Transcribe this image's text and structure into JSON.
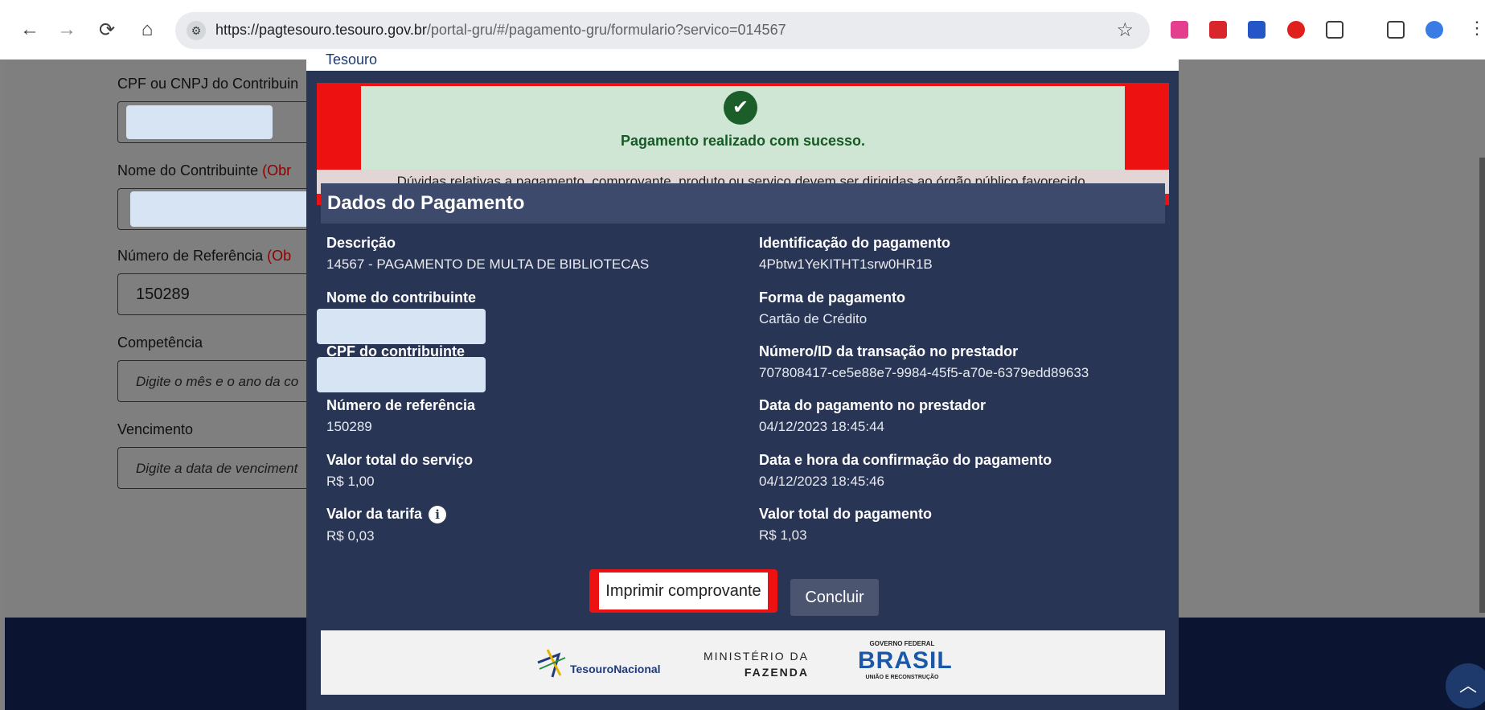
{
  "browser": {
    "url_host": "https://pagtesouro.tesouro.gov.br",
    "url_path": "/portal-gru/#/pagamento-gru/formulario?servico=014567"
  },
  "form": {
    "cpf_label": "CPF ou CNPJ do Contribuin",
    "nome_label": "Nome do Contribuinte",
    "nome_req": "(Obr",
    "ref_label": "Número de Referência",
    "ref_req": "(Ob",
    "ref_value": "150289",
    "competencia_label": "Competência",
    "competencia_placeholder": "Digite o mês e o ano da co",
    "vencimento_label": "Vencimento",
    "vencimento_placeholder": "Digite a data de venciment"
  },
  "modal": {
    "logo_text": "Tesouro",
    "success_title": "Pagamento realizado com sucesso.",
    "success_note": "Dúvidas relativas a pagamento, comprovante, produto ou serviço devem ser dirigidas ao órgão público favorecido.",
    "section_title": "Dados do Pagamento",
    "left_fields": [
      {
        "label": "Descrição",
        "value": "14567 - PAGAMENTO DE MULTA DE BIBLIOTECAS"
      },
      {
        "label": "Nome do contribuinte",
        "value": ""
      },
      {
        "label": "CPF do contribuinte",
        "value": ""
      },
      {
        "label": "Número de referência",
        "value": "150289"
      },
      {
        "label": "Valor total do serviço",
        "value": "R$  1,00"
      },
      {
        "label": "Valor da tarifa",
        "value": "R$  0,03"
      }
    ],
    "right_fields": [
      {
        "label": "Identificação do pagamento",
        "value": "4Pbtw1YeKITHT1srw0HR1B"
      },
      {
        "label": "Forma de pagamento",
        "value": "Cartão de Crédito"
      },
      {
        "label": "Número/ID da transação no prestador",
        "value": "707808417-ce5e88e7-9984-45f5-a70e-6379edd89633"
      },
      {
        "label": "Data do pagamento no prestador",
        "value": "04/12/2023 18:45:44"
      },
      {
        "label": "Data e hora da confirmação do pagamento",
        "value": "04/12/2023 18:45:46"
      },
      {
        "label": "Valor total do pagamento",
        "value": "R$  1,03"
      }
    ],
    "print_button": "Imprimir comprovante",
    "concluir_button": "Concluir",
    "footer": {
      "tesouro_text": "TesouroNacional",
      "ministerio_line1": "MINISTÉRIO DA",
      "ministerio_line2": "FAZENDA",
      "gov_line1": "GOVERNO FEDERAL",
      "gov_word": "BRASIL",
      "gov_line2": "UNIÃO E RECONSTRUÇÃO"
    }
  },
  "icons": [
    "back-arrow-icon",
    "forward-arrow-icon",
    "reload-icon",
    "home-icon",
    "site-settings-icon",
    "star-icon",
    "check-icon",
    "info-icon",
    "chevron-up-icon",
    "menu-dots-icon"
  ]
}
